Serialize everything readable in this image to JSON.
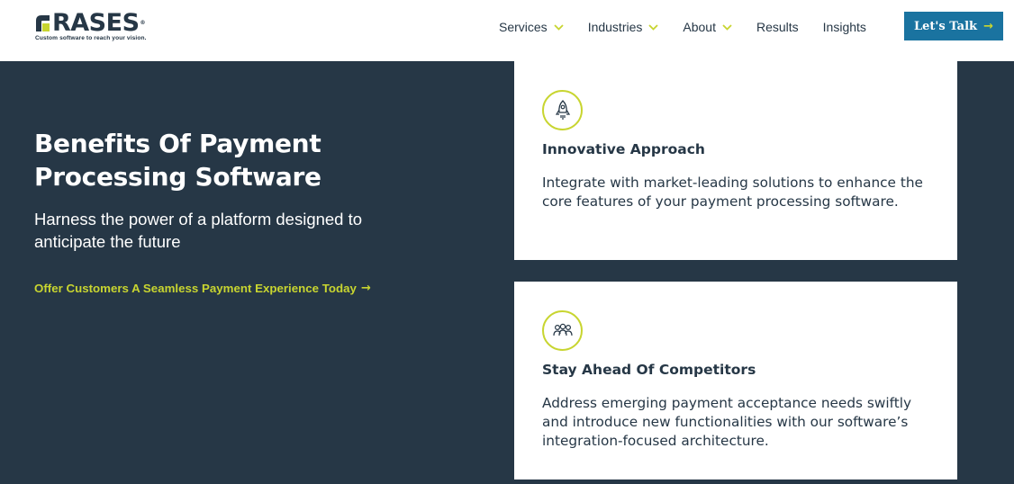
{
  "brand": {
    "name": "RASES",
    "tagline": "Custom software to reach your vision.",
    "trademark": "®",
    "accent_color": "#c8d530",
    "dark_color": "#263746",
    "cta_color": "#1a73a0"
  },
  "nav": {
    "items": [
      {
        "label": "Services",
        "has_dropdown": true
      },
      {
        "label": "Industries",
        "has_dropdown": true
      },
      {
        "label": "About",
        "has_dropdown": true
      },
      {
        "label": "Results",
        "has_dropdown": false
      },
      {
        "label": "Insights",
        "has_dropdown": false
      }
    ],
    "cta_label": "Let's Talk"
  },
  "hero": {
    "title": "Benefits Of Payment Processing Software",
    "subtitle": "Harness the power of a platform designed to anticipate the future",
    "link_label": "Offer Customers A Seamless Payment Experience Today"
  },
  "cards": [
    {
      "icon": "rocket-icon",
      "title": "Innovative Approach",
      "text": "Integrate with market-leading solutions to enhance the core features of your payment processing software."
    },
    {
      "icon": "team-icon",
      "title": "Stay Ahead Of Competitors",
      "text": "Address emerging payment acceptance needs swiftly and introduce new functionalities with our software’s integration-focused architecture."
    }
  ]
}
